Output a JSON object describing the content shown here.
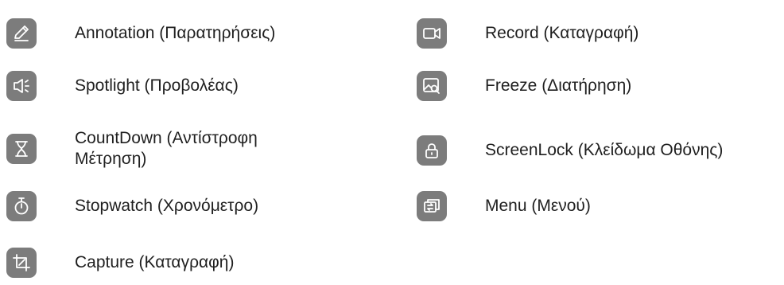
{
  "left": [
    {
      "label": "Annotation (Παρατηρήσεις)",
      "icon": "pen-icon"
    },
    {
      "label": "Spotlight (Προβολέας)",
      "icon": "speaker-icon"
    },
    {
      "label": "CountDown (Αντίστροφη Μέτρηση)",
      "icon": "hourglass-icon"
    },
    {
      "label": "Stopwatch (Χρονόμετρο)",
      "icon": "stopwatch-icon"
    },
    {
      "label": "Capture (Καταγραφή)",
      "icon": "crop-icon"
    }
  ],
  "right": [
    {
      "label": "Record (Καταγραφή)",
      "icon": "video-camera-icon"
    },
    {
      "label": "Freeze (Διατήρηση)",
      "icon": "freeze-image-icon"
    },
    {
      "label": "ScreenLock (Κλείδωμα Οθόνης)",
      "icon": "lock-icon"
    },
    {
      "label": "Menu (Μενού)",
      "icon": "menu-icon"
    }
  ],
  "colors": {
    "icon_bg": "#7c7c7c",
    "icon_fg": "#ffffff",
    "text": "#1f1f1f"
  }
}
